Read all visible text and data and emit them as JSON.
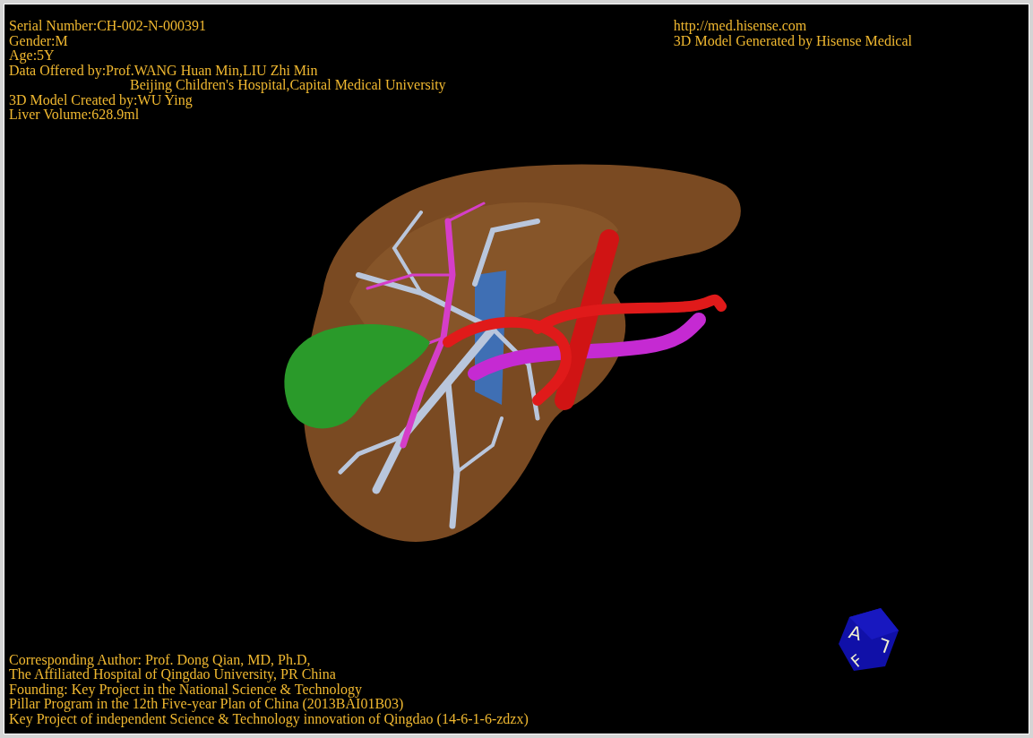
{
  "viewer": {
    "info_top_left": [
      {
        "kind": "line",
        "text": "Serial Number:CH-002-N-000391"
      },
      {
        "kind": "line",
        "text": "Gender:M"
      },
      {
        "kind": "line",
        "text": "Age:5Y"
      },
      {
        "kind": "line",
        "text": "Data Offered by:Prof.WANG Huan Min,LIU Zhi Min"
      },
      {
        "kind": "continuation",
        "text": "Beijing Children's Hospital,Capital Medical University"
      },
      {
        "kind": "line",
        "text": "3D Model Created by:WU Ying"
      },
      {
        "kind": "line",
        "text": "Liver Volume:628.9ml"
      }
    ],
    "info_top_right": [
      "http://med.hisense.com",
      "3D Model Generated by Hisense Medical"
    ],
    "credits": [
      "Corresponding Author: Prof. Dong Qian, MD, Ph.D,",
      "The Affiliated Hospital of Qingdao University, PR China",
      "Founding: Key Project in the National Science & Technology",
      "Pillar Program in the 12th Five-year Plan of China (2013BAI01B03)",
      "Key Project of independent Science & Technology innovation of Qingdao (14-6-1-6-zdzx)"
    ],
    "orientation_cube": {
      "faces": [
        "A",
        "L",
        "F"
      ]
    }
  }
}
